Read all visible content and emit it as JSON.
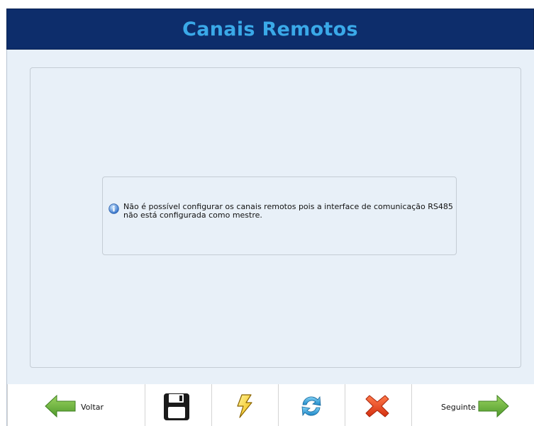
{
  "header": {
    "title": "Canais Remotos"
  },
  "message": {
    "icon": "info-icon",
    "text": "Não é possível configurar os canais remotos pois a interface de comunicação RS485 não está configurada como mestre."
  },
  "toolbar": {
    "back_label": "Voltar",
    "next_label": "Seguinte",
    "buttons": [
      {
        "name": "back-button",
        "icon": "arrow-left-icon"
      },
      {
        "name": "save-button",
        "icon": "floppy-disk-icon"
      },
      {
        "name": "apply-button",
        "icon": "lightning-icon"
      },
      {
        "name": "refresh-button",
        "icon": "refresh-icon"
      },
      {
        "name": "cancel-button",
        "icon": "close-icon"
      },
      {
        "name": "next-button",
        "icon": "arrow-right-icon"
      }
    ]
  },
  "colors": {
    "title_bar_bg": "#0d2d6b",
    "title_text": "#3aa9e8",
    "content_bg": "#e8f0f8",
    "arrow_green": "#6cb33f",
    "close_red": "#e8431c",
    "refresh_blue": "#2f9fd8",
    "lightning_yellow": "#f5d41e"
  }
}
